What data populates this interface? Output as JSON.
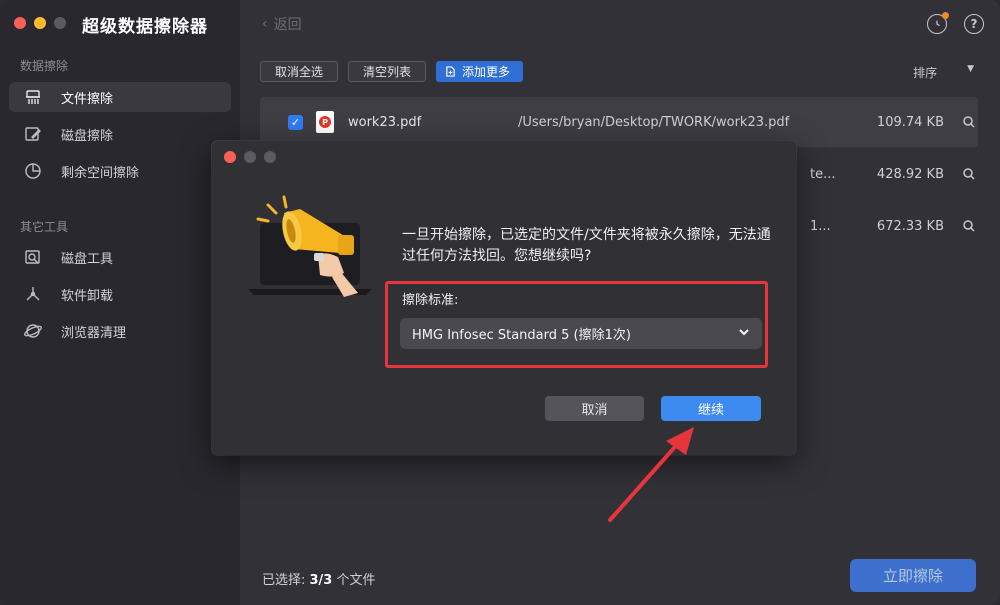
{
  "app": {
    "title": "超级数据擦除器"
  },
  "sidebar": {
    "section1_label": "数据擦除",
    "section2_label": "其它工具",
    "items": [
      {
        "label": "文件擦除",
        "icon": "shredder-icon",
        "active": true
      },
      {
        "label": "磁盘擦除",
        "icon": "disk-erase-icon",
        "active": false
      },
      {
        "label": "剩余空间擦除",
        "icon": "pie-chart-icon",
        "active": false
      },
      {
        "label": "磁盘工具",
        "icon": "disk-tool-icon",
        "active": false
      },
      {
        "label": "软件卸载",
        "icon": "uninstall-icon",
        "active": false
      },
      {
        "label": "浏览器清理",
        "icon": "browser-icon",
        "active": false
      }
    ]
  },
  "header": {
    "back_label": "返回"
  },
  "toolbar": {
    "deselect_all": "取消全选",
    "clear_list": "清空列表",
    "add_more": "添加更多",
    "sort_label": "排序"
  },
  "files": [
    {
      "name": "work23.pdf",
      "path": "/Users/bryan/Desktop/TWORK/work23.pdf",
      "size": "109.74 KB",
      "checked": true
    },
    {
      "name": "",
      "path": "te...",
      "size": "428.92 KB",
      "checked": true
    },
    {
      "name": "",
      "path": "1...",
      "size": "672.33 KB",
      "checked": true
    }
  ],
  "footer": {
    "selected_prefix": "已选择: ",
    "selected_count": "3/3",
    "selected_suffix": " 个文件",
    "erase_now": "立即擦除"
  },
  "dialog": {
    "message": "一旦开始擦除，已选定的文件/文件夹将被永久擦除，无法通过任何方法找回。您想继续吗?",
    "standard_label": "擦除标准:",
    "selected_standard": "HMG Infosec Standard 5 (擦除1次)",
    "cancel": "取消",
    "continue": "继续"
  },
  "colors": {
    "accent": "#3d8bf0",
    "highlight": "#e8353b",
    "warning_badge": "#f08a24"
  }
}
